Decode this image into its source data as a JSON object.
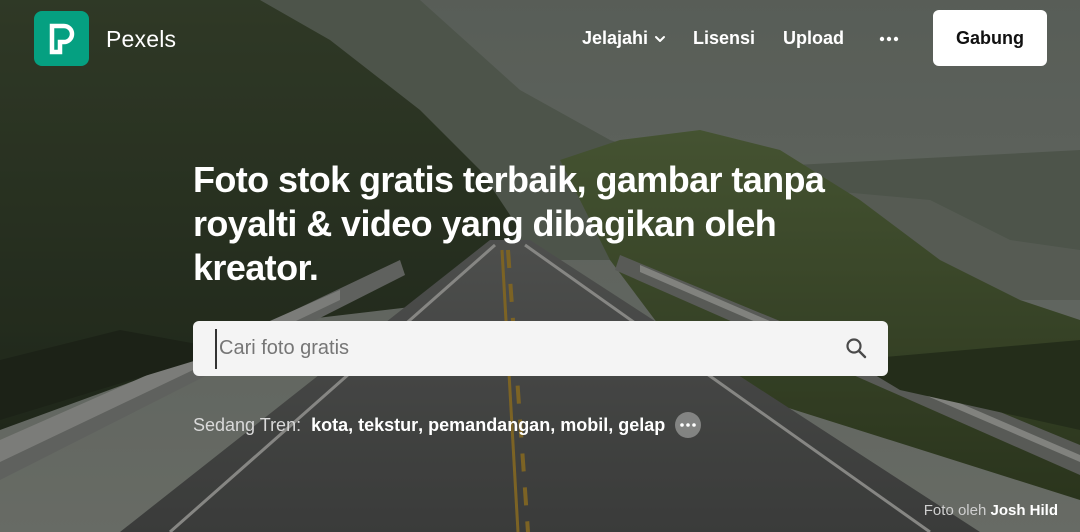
{
  "header": {
    "brand": "Pexels",
    "nav": {
      "explore": "Jelajahi",
      "license": "Lisensi",
      "upload": "Upload"
    },
    "more_icon": "ellipsis-icon",
    "join_label": "Gabung"
  },
  "hero": {
    "headline": "Foto stok gratis terbaik, gambar tanpa royalti & video yang dibagikan oleh kreator.",
    "search": {
      "placeholder": "Cari foto gratis",
      "value": ""
    },
    "trending": {
      "label": "Sedang Tren:",
      "items": [
        "kota",
        "tekstur",
        "pemandangan",
        "mobil",
        "gelap"
      ]
    }
  },
  "credit": {
    "label": "Foto oleh",
    "author": "Josh Hild"
  },
  "colors": {
    "brand": "#05a081",
    "button_bg": "#ffffff",
    "search_bg": "#f4f4f4"
  }
}
